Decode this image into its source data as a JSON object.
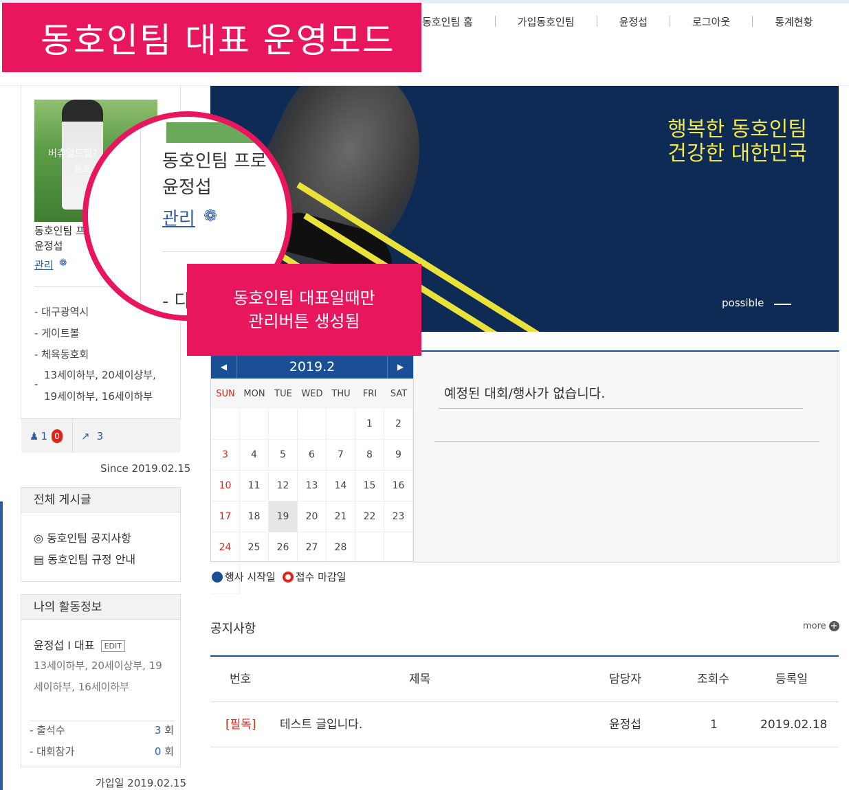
{
  "banner": {
    "mode_title": "동호인팀 대표 운영모드"
  },
  "nav": {
    "items": [
      "동호인팀 홈",
      "가입동호인팀",
      "윤정섭",
      "로그아웃",
      "통계현황"
    ]
  },
  "profile": {
    "image_line1": "버츄얼드림?",
    "image_line2": "동호",
    "team_name": "동호인팀 프",
    "rep_name": "윤정섭",
    "manage_label": "관리",
    "info": [
      "- 대구광역시",
      "- 게이트볼",
      "- 체육동호회"
    ],
    "ages_line1": "13세이하부, 20세이상부,",
    "ages_line2": "19세이하부, 16세이하부",
    "ages_dash": "-",
    "member_count": "1",
    "member_pending": "0",
    "visit_count": "3",
    "since": "Since 2019.02.15"
  },
  "zoom": {
    "team_name": "동호인팀 프로",
    "rep_name": "윤정섭",
    "manage_label": "관리",
    "dash": "- 다"
  },
  "callout": {
    "line1": "동호인팀 대표일때만",
    "line2": "관리버튼 생성됨"
  },
  "hero": {
    "slogan1": "행복한 동호인팀",
    "slogan2": "건강한 대한민국",
    "possible": "possible"
  },
  "board": {
    "title": "전체 게시글",
    "items": [
      "동호인팀 공지사항",
      "동호인팀 규정 안내"
    ]
  },
  "activity": {
    "title": "나의 활동정보",
    "name": "윤정섭 I 대표",
    "edit_label": "EDIT",
    "ages": "13세이하부, 20세이상부, 19세이하부, 16세이하부",
    "attendance_label": "- 출석수",
    "attendance_value": "3",
    "tournament_label": "- 대회참가",
    "tournament_value": "0",
    "unit": "회",
    "joined": "가입일 2019.02.15"
  },
  "calendar": {
    "month": "2019.2",
    "dow": [
      "SUN",
      "MON",
      "TUE",
      "WED",
      "THU",
      "FRI",
      "SAT"
    ],
    "days": [
      "",
      "",
      "",
      "",
      "",
      "1",
      "2",
      "3",
      "4",
      "5",
      "6",
      "7",
      "8",
      "9",
      "10",
      "11",
      "12",
      "13",
      "14",
      "15",
      "16",
      "17",
      "18",
      "19",
      "20",
      "21",
      "22",
      "23",
      "24",
      "25",
      "26",
      "27",
      "28",
      "",
      "",
      ""
    ],
    "today": "19"
  },
  "legend": {
    "start": "행사 시작일",
    "deadline": "접수 마감일"
  },
  "events": {
    "empty": "예정된 대회/행사가 없습니다."
  },
  "notices": {
    "title": "공지사항",
    "more": "more",
    "headers": [
      "번호",
      "제목",
      "담당자",
      "조회수",
      "등록일"
    ],
    "rows": [
      {
        "badge": "[필독]",
        "title": "테스트 글입니다.",
        "author": "윤정섭",
        "views": "1",
        "date": "2019.02.18"
      }
    ]
  },
  "colors": {
    "accent_pink": "#e8175d",
    "brand_blue": "#1a4f96",
    "slogan_yellow": "#f2e84a"
  }
}
